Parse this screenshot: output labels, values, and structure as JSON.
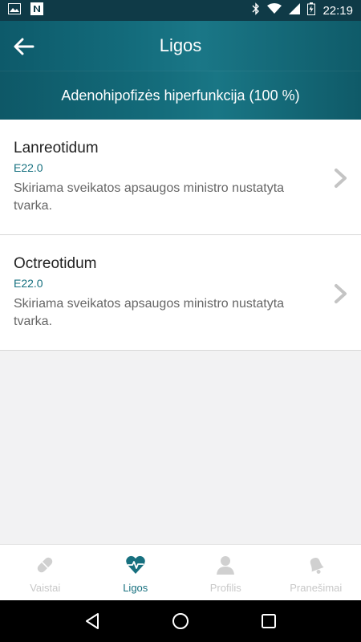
{
  "status_bar": {
    "time": "22:19"
  },
  "app_bar": {
    "title": "Ligos"
  },
  "subheader": {
    "text": "Adenohipofizės hiperfunkcija (100 %)"
  },
  "items": [
    {
      "title": "Lanreotidum",
      "code": "E22.0",
      "description": "Skiriama sveikatos apsaugos ministro nustatyta tvarka."
    },
    {
      "title": "Octreotidum",
      "code": "E22.0",
      "description": "Skiriama sveikatos apsaugos ministro nustatyta tvarka."
    }
  ],
  "bottom_nav": [
    {
      "label": "Vaistai",
      "icon": "pill-icon",
      "active": false
    },
    {
      "label": "Ligos",
      "icon": "heart-pulse-icon",
      "active": true
    },
    {
      "label": "Profilis",
      "icon": "person-icon",
      "active": false
    },
    {
      "label": "Pranešimai",
      "icon": "bell-icon",
      "active": false
    }
  ],
  "colors": {
    "accent": "#17707f",
    "header": "#136b7b",
    "inactive": "#c8c8c8"
  }
}
